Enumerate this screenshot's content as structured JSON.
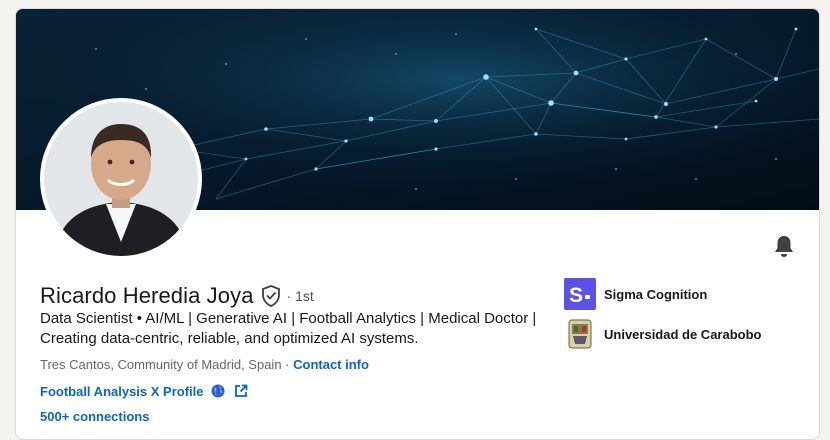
{
  "profile": {
    "name": "Ricardo Heredia Joya",
    "degree": "· 1st",
    "headline": "Data Scientist • AI/ML | Generative AI | Football Analytics | Medical Doctor | Creating data-centric, reliable, and optimized AI systems.",
    "location": "Tres Cantos, Community of Madrid, Spain · ",
    "contact_info": "Contact info",
    "external_link": "Football Analysis X Profile",
    "connections": "500+ connections"
  },
  "organizations": [
    {
      "name": "Sigma Cognition",
      "logo": "sigma-cognition-logo"
    },
    {
      "name": "Universidad de Carabobo",
      "logo": "universidad-de-carabobo-seal"
    }
  ],
  "colors": {
    "link": "#0a66c2",
    "text": "#191919",
    "secondary": "#666666",
    "sigma_brand": "#5b53e8",
    "banner": "#071a2b"
  },
  "icons": [
    "verified-icon",
    "bell-icon",
    "globe-icon",
    "external-link-icon"
  ]
}
